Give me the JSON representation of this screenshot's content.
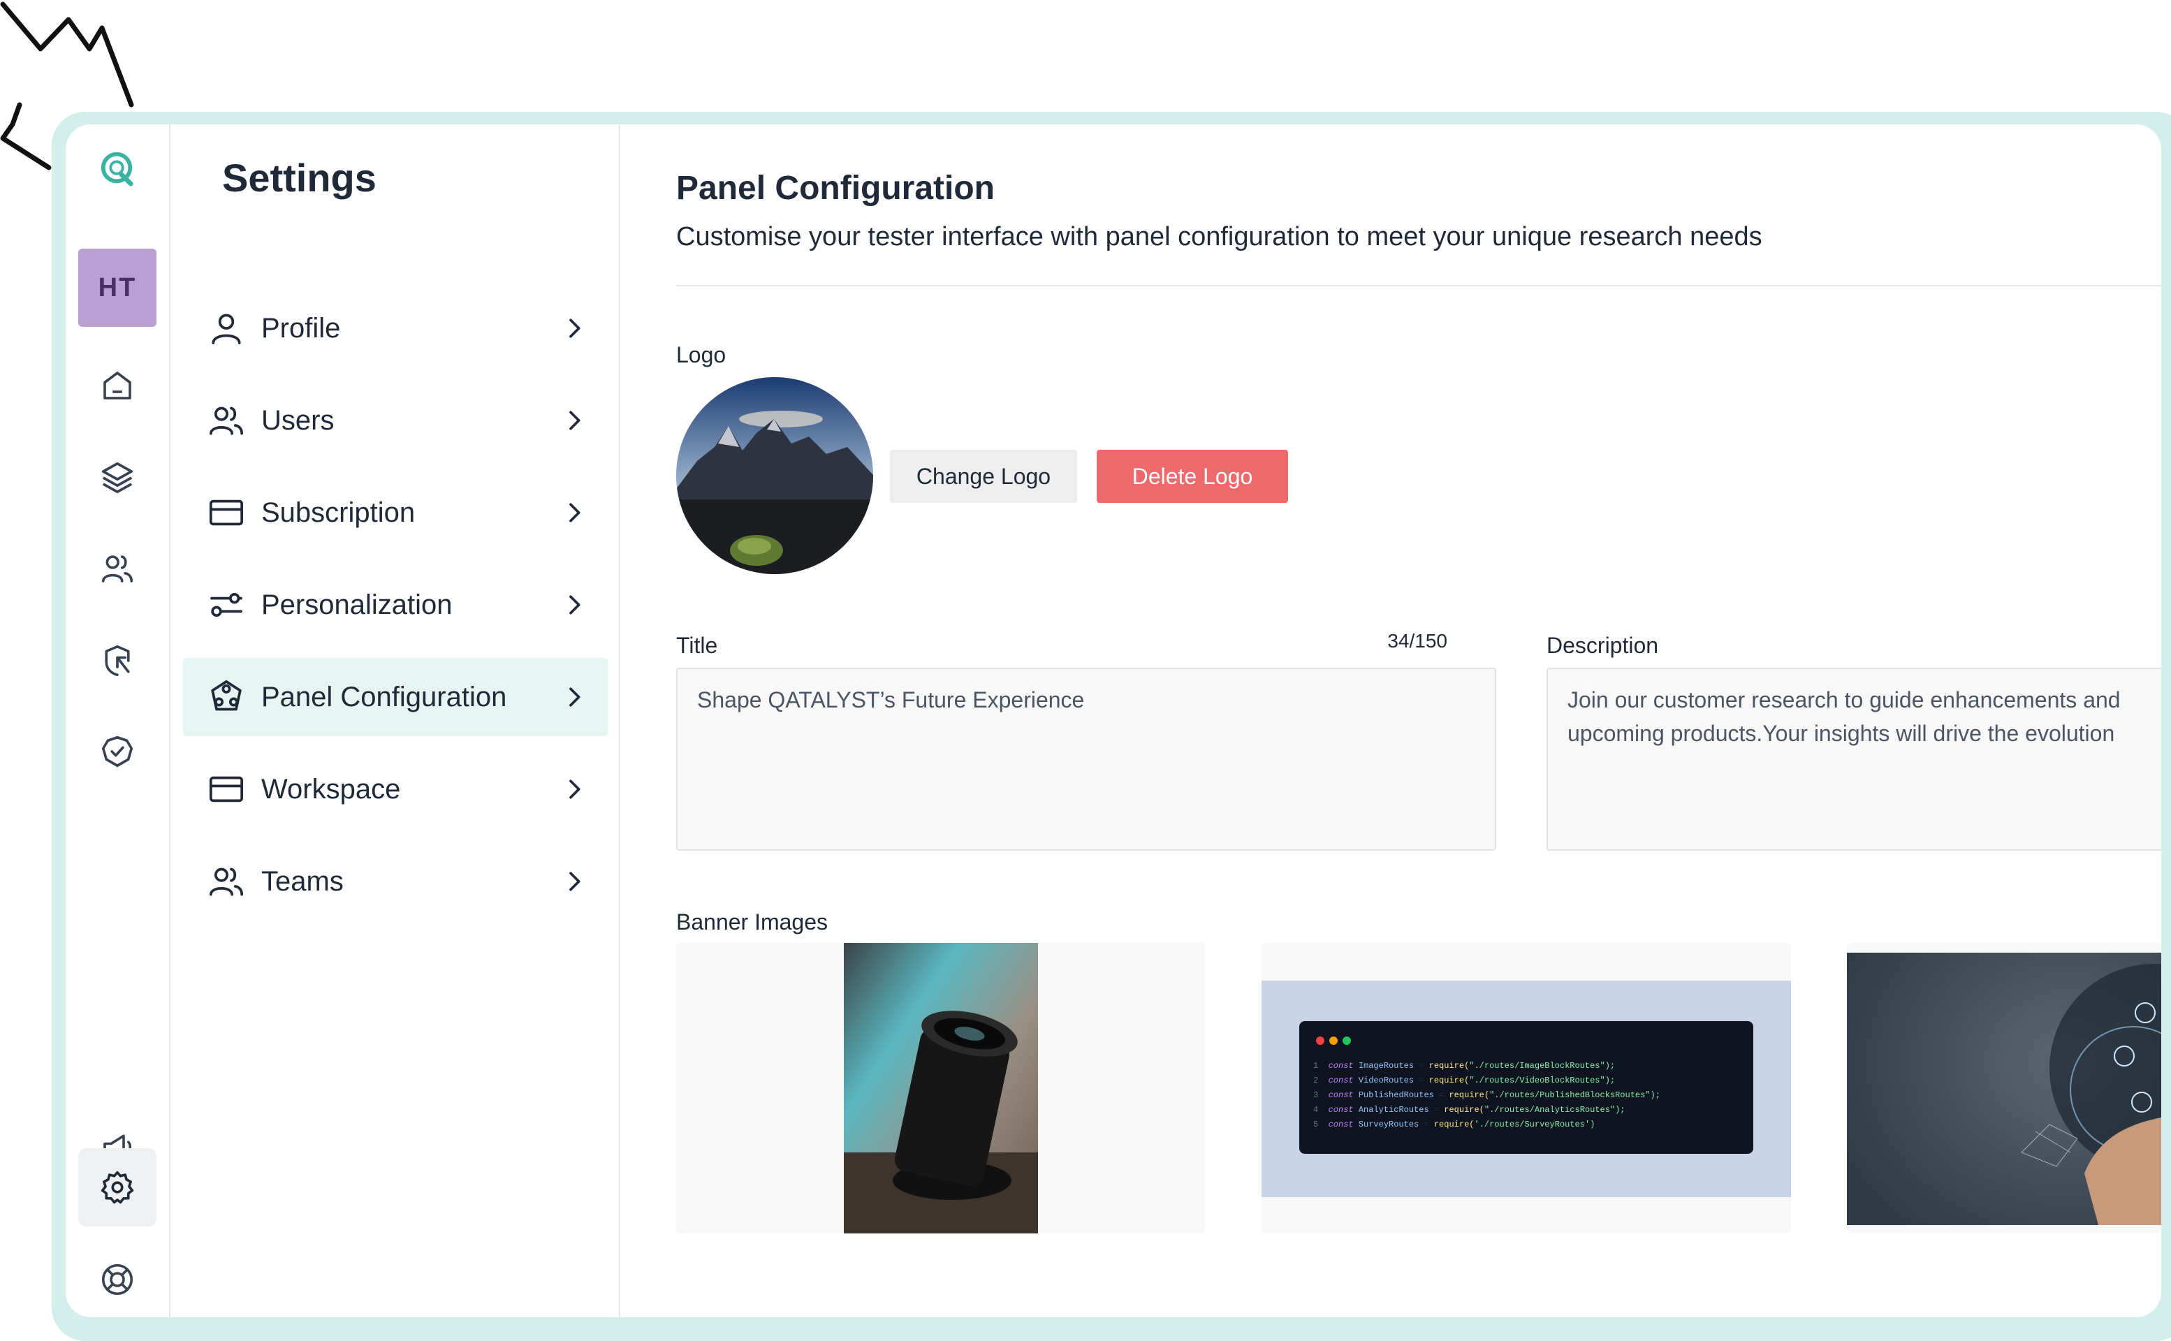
{
  "colors": {
    "accent": "#3bb3a2",
    "frame": "#d3efeb",
    "avatar_bg": "#bb9fd3",
    "delete_button": "#ec6a6c",
    "active_menu_bg": "#e6f4f2"
  },
  "rail": {
    "avatar_initials": "HT",
    "icons": [
      "app-logo-icon",
      "home-icon",
      "layers-icon",
      "users-icon",
      "cursor-click-icon",
      "check-badge-icon",
      "megaphone-icon",
      "gear-icon",
      "lifebuoy-icon"
    ],
    "active": "gear-icon"
  },
  "settings": {
    "title": "Settings",
    "items": [
      {
        "label": "Profile",
        "icon": "user-icon"
      },
      {
        "label": "Users",
        "icon": "users-icon"
      },
      {
        "label": "Subscription",
        "icon": "credit-card-icon"
      },
      {
        "label": "Personalization",
        "icon": "sliders-icon"
      },
      {
        "label": "Panel Configuration",
        "icon": "panel-icon",
        "active": true
      },
      {
        "label": "Workspace",
        "icon": "credit-card-icon"
      },
      {
        "label": "Teams",
        "icon": "users-icon"
      }
    ]
  },
  "main": {
    "title": "Panel Configuration",
    "subtitle": "Customise your tester interface with panel configuration to meet your unique research needs",
    "logo_label": "Logo",
    "change_logo": "Change Logo",
    "delete_logo": "Delete Logo",
    "title_label": "Title",
    "title_counter": "34/150",
    "title_value": "Shape QATALYST’s Future Experience",
    "description_label": "Description",
    "description_line1": "Join our customer research to guide enhancements and",
    "description_line2": "upcoming products.Your insights will drive the evolution",
    "banner_label": "Banner Images",
    "code_lines": [
      {
        "n": "1",
        "name": "ImageRoutes",
        "path": "\"./routes/ImageBlockRoutes\");"
      },
      {
        "n": "2",
        "name": "VideoRoutes",
        "path": "\"./routes/VideoBlockRoutes\");"
      },
      {
        "n": "3",
        "name": "PublishedRoutes",
        "path": "\"./routes/PublishedBlocksRoutes\");"
      },
      {
        "n": "4",
        "name": "AnalyticRoutes",
        "path": "\"./routes/AnalyticsRoutes\");"
      },
      {
        "n": "5",
        "name": "SurveyRoutes",
        "path": "'./routes/SurveyRoutes')"
      }
    ],
    "code_keyword": "const",
    "code_require": "require("
  }
}
